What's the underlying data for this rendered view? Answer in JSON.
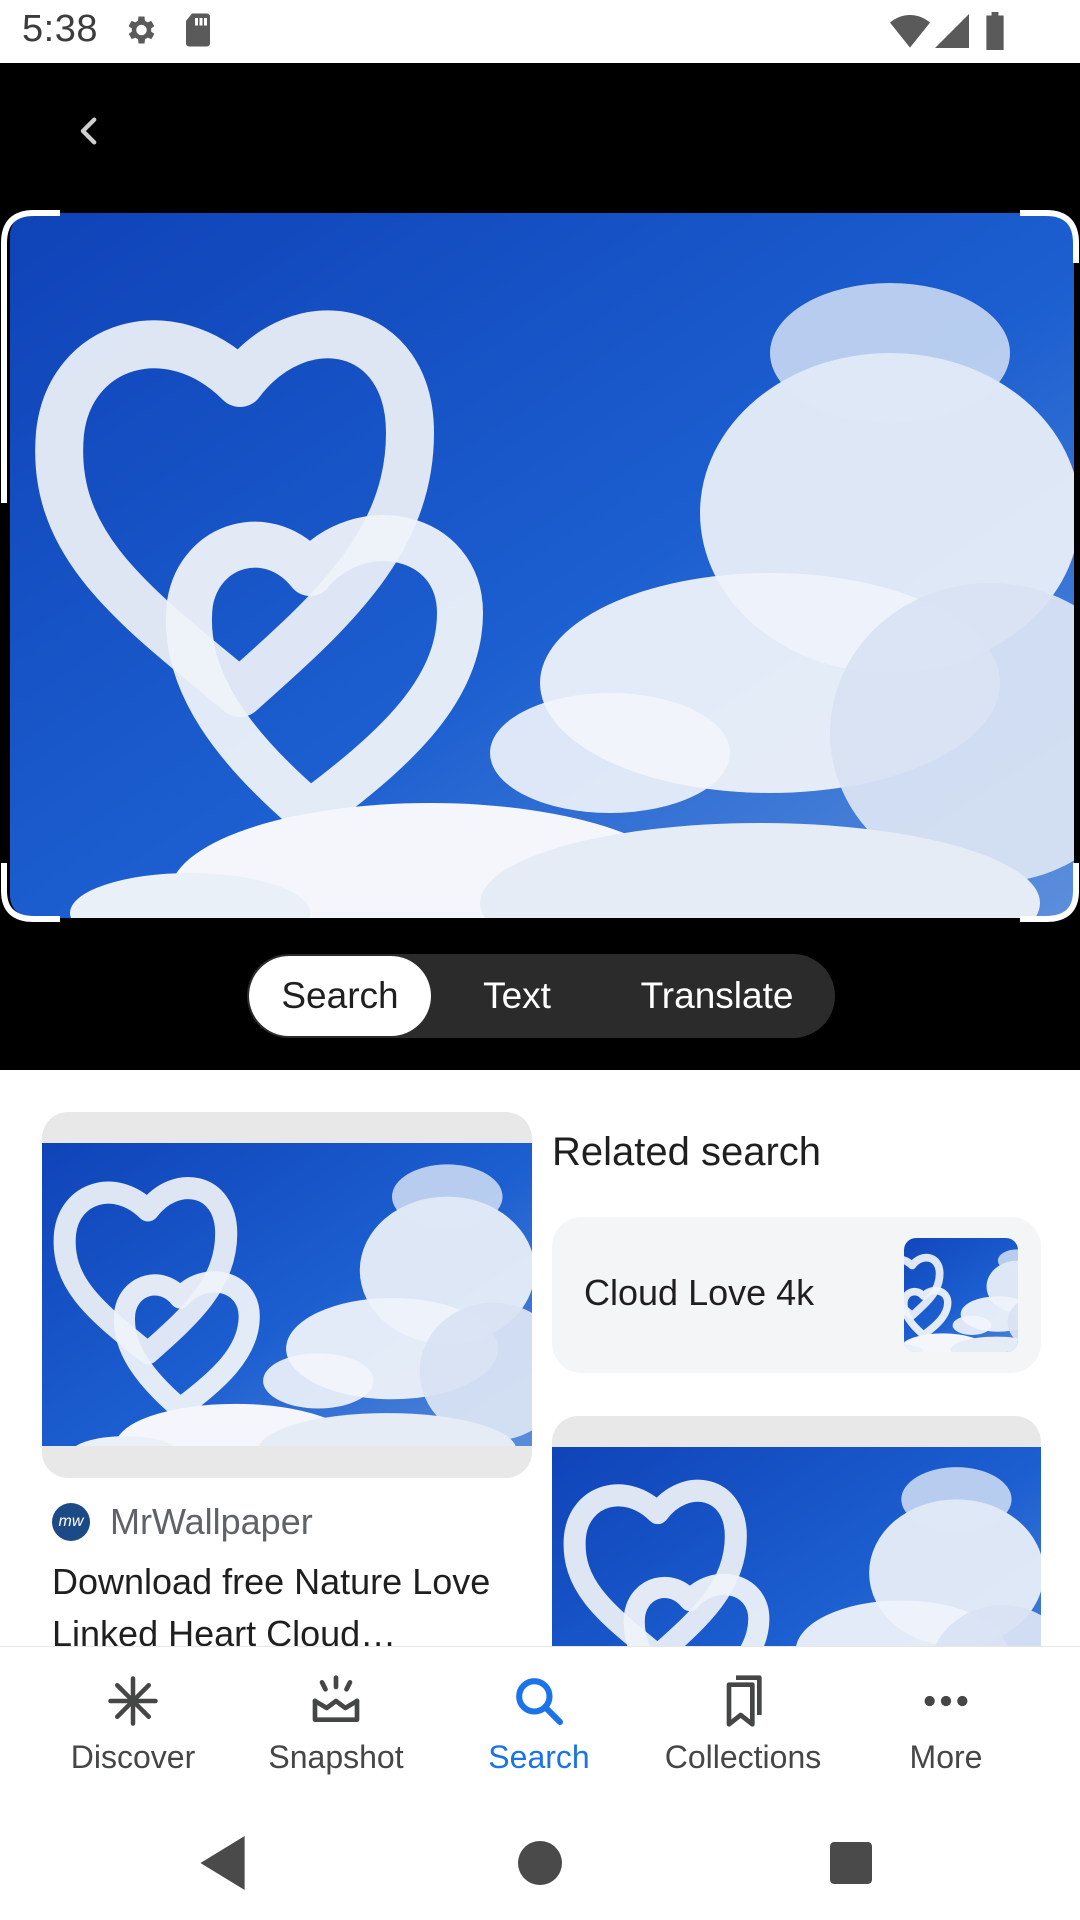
{
  "status_bar": {
    "time": "5:38",
    "icons": [
      "gear-icon",
      "sd-card-icon",
      "wifi-icon",
      "signal-icon",
      "battery-icon"
    ]
  },
  "lens": {
    "back_icon": "chevron-left-icon",
    "photo_description_icon": "cloud-hearts-photo",
    "modes": [
      {
        "label": "Search",
        "active": true
      },
      {
        "label": "Text",
        "active": false
      },
      {
        "label": "Translate",
        "active": false
      }
    ]
  },
  "results": {
    "left_card": {
      "source_logo_text": "mw",
      "source_name": "MrWallpaper",
      "title": "Download free Nature Love Linked Heart Cloud…"
    },
    "related": {
      "heading": "Related search",
      "chip_label": "Cloud Love 4k"
    }
  },
  "bottom_nav": {
    "items": [
      {
        "label": "Discover",
        "icon": "asterisk-icon",
        "active": false
      },
      {
        "label": "Snapshot",
        "icon": "snapshot-icon",
        "active": false
      },
      {
        "label": "Search",
        "icon": "search-icon",
        "active": true
      },
      {
        "label": "Collections",
        "icon": "collections-icon",
        "active": false
      },
      {
        "label": "More",
        "icon": "more-dots-icon",
        "active": false
      }
    ]
  },
  "colors": {
    "accent": "#1a73e8",
    "sky": "#1d57c4",
    "lens_bg": "#000000"
  }
}
